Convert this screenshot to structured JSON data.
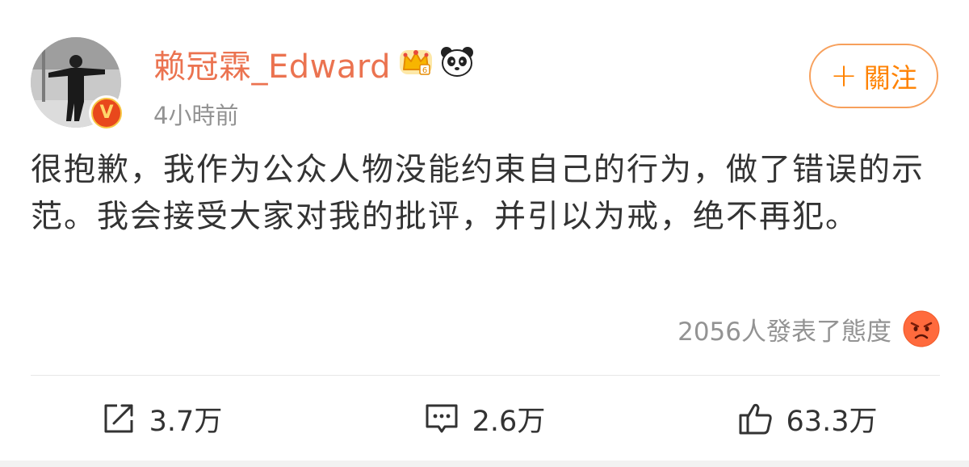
{
  "author": {
    "name": "赖冠霖_Edward",
    "verified_mark": "V",
    "avatar_icon": "user-avatar-photo",
    "badges": [
      "crown-badge-icon",
      "panda-badge-icon"
    ]
  },
  "post": {
    "time": "4小時前",
    "text": "很抱歉，我作为公众人物没能约束自己的行为，做了错误的示范。我会接受大家对我的批评，并引以为戒，绝不再犯。"
  },
  "follow_button": {
    "plus": "+",
    "label": "關注"
  },
  "reactions": {
    "summary": "2056人發表了態度",
    "emoji": "angry-face-icon"
  },
  "actions": {
    "repost": {
      "icon": "repost-icon",
      "count": "3.7万"
    },
    "comment": {
      "icon": "comment-icon",
      "count": "2.6万"
    },
    "like": {
      "icon": "thumbs-up-icon",
      "count": "63.3万"
    }
  },
  "colors": {
    "username": "#eb7350",
    "follow": "#ff8200",
    "follow_border": "#f7a05c",
    "text": "#333333",
    "secondary": "#939393",
    "divider": "#e6e6e6"
  }
}
